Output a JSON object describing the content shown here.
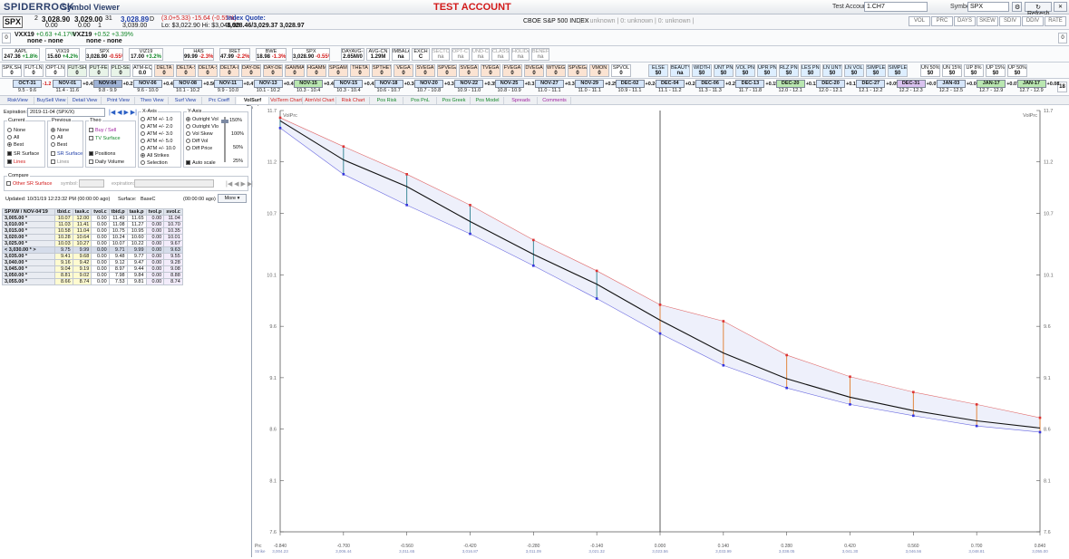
{
  "titlebar": {
    "logo": "SPIDERROCK",
    "app_name": "Symbol Viewer",
    "account_banner": "TEST ACCOUNT",
    "test_account_label": "Test Account:",
    "test_account_value": "1.CH7",
    "symbol_label": "Symbol:",
    "symbol_value": "SPX",
    "refresh_label": "Refresh",
    "window_buttons": [
      "▁",
      "❐",
      "✕"
    ]
  },
  "quote": {
    "symbol": "SPX",
    "bid_size": "2",
    "bid": "3,028.90",
    "ask": "3,029.00",
    "ask_size": "31",
    "last": "3,028.89",
    "last_suffix": "D",
    "sub_bid": "0.00",
    "sub_ask": "0.00",
    "sub_ask_size": "1",
    "sub_last": "3,039.00",
    "change": "(3.0+5.33) -15.64 (-0.55%)",
    "lo_hi": "Lo: $3,022.90  Hi: $3,046.90",
    "index_label": "Index Quote:",
    "index_value": "3,028.46/3,029.37 3,028.97",
    "name_cell": "CBOE S&P 500 INDEX",
    "name_status": "| 0: unknown | 0: unknown | 0: unknown |",
    "right_buttons": [
      "VOL",
      "PRC",
      "DAYS",
      "SKEW",
      "SDIV",
      "DDIV",
      "RATE"
    ]
  },
  "vx_strip": {
    "items": [
      {
        "name": "VXX19",
        "text": "+0.63  +4.17%",
        "sub": "none - none"
      },
      {
        "name": "VXZ19",
        "text": "+0.52  +3.39%",
        "sub": "none - none"
      }
    ],
    "corner": "0"
  },
  "metrics": [
    {
      "label": "AAPL",
      "value": "247.36",
      "chg": "+1.8%",
      "cls": "green"
    },
    {
      "label": "VIX19",
      "value": "15.60",
      "chg": "+4.2%",
      "cls": "green"
    },
    {
      "label": "SPX",
      "value": "3,028.90",
      "chg": "-0.55%",
      "cls": "red"
    },
    {
      "label": "VIZ19",
      "value": "17.00",
      "chg": "+3.2%",
      "cls": "green"
    },
    {
      "label": "HAS",
      "value": "99.99",
      "chg": "-2.3%",
      "cls": "red"
    },
    {
      "label": "IRET",
      "value": "47.99",
      "chg": "-2.2%",
      "cls": "red"
    },
    {
      "label": "BWE",
      "value": "18.98",
      "chg": "-1.3%",
      "cls": "red"
    },
    {
      "label": "SPX",
      "value": "3,028.90",
      "chg": "-0.55%",
      "cls": "red"
    }
  ],
  "metrics_right": [
    {
      "label": "DAYAVG-SH",
      "value": "2.65M/0"
    },
    {
      "label": "AVG-CN",
      "value": "1.29M"
    },
    {
      "label": "IMBALANCE",
      "value": "na"
    },
    {
      "label": "EXCH",
      "value": "C"
    },
    {
      "label": "SECTOR",
      "value": "na"
    },
    {
      "label": "OPT-CTRL",
      "value": "na"
    },
    {
      "label": "UND-CTRL",
      "value": "na"
    },
    {
      "label": "CLASS",
      "value": "na"
    },
    {
      "label": "HOLIDAYSIGN",
      "value": "na"
    },
    {
      "label": "BENEFIT",
      "value": "na"
    }
  ],
  "greek_cells": [
    {
      "l": "SPK.SH",
      "v": "0"
    },
    {
      "l": "FUT-LN",
      "v": "0"
    },
    {
      "l": "OPT-LN",
      "v": "0"
    },
    {
      "l": "FUT-SH",
      "v": "0"
    },
    {
      "l": "PUT-FEE",
      "v": "0"
    },
    {
      "l": "PLD-SELL",
      "v": "0"
    },
    {
      "l": "ATM-EQ-LN",
      "v": "0.0"
    },
    {
      "l": "DELTA",
      "v": "0"
    },
    {
      "l": "DELTA-S",
      "v": "0"
    },
    {
      "l": "DELTA-S",
      "v": "0"
    },
    {
      "l": "DELTA-L",
      "v": "0"
    },
    {
      "l": "DAY-DELTA",
      "v": "0"
    },
    {
      "l": "DAY-DELTA",
      "v": "0"
    },
    {
      "l": "GAMMA",
      "v": "0"
    },
    {
      "l": "HGAMMA",
      "v": "0"
    },
    {
      "l": "SPGAMMA",
      "v": "0"
    },
    {
      "l": "THETA",
      "v": "0"
    },
    {
      "l": "SPTHETA",
      "v": "0"
    },
    {
      "l": "VEGA",
      "v": "0"
    },
    {
      "l": "SVEGA",
      "v": "0"
    },
    {
      "l": "SPVEGA",
      "v": "0"
    },
    {
      "l": "SVEGA",
      "v": "0"
    },
    {
      "l": "TVEGA",
      "v": "0"
    },
    {
      "l": "FVEGA",
      "v": "0"
    },
    {
      "l": "DVEGA",
      "v": "0"
    },
    {
      "l": "WTVEGA",
      "v": "0"
    },
    {
      "l": "SPVEGA",
      "v": "0"
    },
    {
      "l": "VMON",
      "v": "0"
    },
    {
      "l": "SPVOL",
      "v": "0"
    },
    {
      "l": "ELSE",
      "v": "$0"
    },
    {
      "l": "BEAUTY",
      "v": "na"
    },
    {
      "l": "WIDTH",
      "v": "$0"
    },
    {
      "l": "UNT PNL",
      "v": "$0"
    },
    {
      "l": "VOL PNL",
      "v": "$0"
    },
    {
      "l": "UPR PNL",
      "v": "$0"
    },
    {
      "l": "RLZ PNL",
      "v": "$0"
    },
    {
      "l": "LES PNL",
      "v": "$0"
    },
    {
      "l": "LN UNT PNL",
      "v": "$0"
    },
    {
      "l": "LN VOL PNL",
      "v": "$0"
    },
    {
      "l": "SIMPLE PNL",
      "v": "$0"
    },
    {
      "l": "SIMPLEV PNL",
      "v": "$0"
    },
    {
      "l": "UN 50%",
      "v": "$0"
    },
    {
      "l": "UN 15%",
      "v": "$0"
    },
    {
      "l": "UP 8%",
      "v": "$0"
    },
    {
      "l": "UP 15%",
      "v": "$0"
    },
    {
      "l": "UP 50%",
      "v": "$0"
    }
  ],
  "expiries": [
    {
      "lab": "OCT-31",
      "rng": "9.5 - 9.6",
      "chg": "-1.2",
      "hl": "blue"
    },
    {
      "lab": "NOV-01",
      "rng": "11.4 - 11.6",
      "chg": "+0.41",
      "hl": "blue"
    },
    {
      "lab": "NOV-04",
      "rng": "9.8 - 9.9",
      "chg": "+0.21",
      "hl": "dark"
    },
    {
      "lab": "NOV-06",
      "rng": "9.6 - 10.0",
      "chg": "+0.42",
      "hl": "blue"
    },
    {
      "lab": "NOV-08",
      "rng": "10.1 - 10.2",
      "chg": "+0.50",
      "hl": "blue"
    },
    {
      "lab": "NOV-11",
      "rng": "9.9 - 10.0",
      "chg": "+0.47",
      "hl": "blue"
    },
    {
      "lab": "NOV-13",
      "rng": "10.1 - 10.2",
      "chg": "+0.43",
      "hl": "blue"
    },
    {
      "lab": "NOV-15",
      "rng": "10.3 - 10.4",
      "chg": "+0.41",
      "hl": "green"
    },
    {
      "lab": "NOV-15",
      "rng": "10.3 - 10.4",
      "chg": "+0.41",
      "hl": "blue"
    },
    {
      "lab": "NOV-18",
      "rng": "10.6 - 10.7",
      "chg": "+0.38",
      "hl": "blue"
    },
    {
      "lab": "NOV-20",
      "rng": "10.7 - 10.8",
      "chg": "+0.32",
      "hl": "blue"
    },
    {
      "lab": "NOV-22",
      "rng": "10.9 - 11.0",
      "chg": "+0.35",
      "hl": "blue"
    },
    {
      "lab": "NOV-25",
      "rng": "10.8 - 10.9",
      "chg": "+0.31",
      "hl": "blue"
    },
    {
      "lab": "NOV-27",
      "rng": "11.0 - 11.1",
      "chg": "+0.30",
      "hl": "blue"
    },
    {
      "lab": "NOV-29",
      "rng": "11.0 - 11.1",
      "chg": "+0.25",
      "hl": "blue"
    },
    {
      "lab": "DEC-02",
      "rng": "10.9 - 11.1",
      "chg": "+0.24",
      "hl": "blue"
    },
    {
      "lab": "DEC-04",
      "rng": "11.1 - 11.2",
      "chg": "+0.24",
      "hl": "blue"
    },
    {
      "lab": "DEC-06",
      "rng": "11.3 - 11.3",
      "chg": "+0.22",
      "hl": "blue"
    },
    {
      "lab": "DEC-13",
      "rng": "11.7 - 11.8",
      "chg": "+0.15",
      "hl": "blue"
    },
    {
      "lab": "DEC-20",
      "rng": "12.0 - 12.1",
      "chg": "+0.12",
      "hl": "green"
    },
    {
      "lab": "DEC-20",
      "rng": "12.0 - 12.1",
      "chg": "+0.10",
      "hl": "blue"
    },
    {
      "lab": "DEC-27",
      "rng": "12.1 - 12.2",
      "chg": "+0.09",
      "hl": "blue"
    },
    {
      "lab": "DEC-31",
      "rng": "12.2 - 12.3",
      "chg": "+0.07",
      "hl": "purple"
    },
    {
      "lab": "JAN-03",
      "rng": "12.2 - 12.5",
      "chg": "+0.00",
      "hl": "blue"
    },
    {
      "lab": "JAN-17",
      "rng": "12.7 - 12.9",
      "chg": "+0.07",
      "hl": "green"
    },
    {
      "lab": "JAN-17",
      "rng": "12.7 - 12.9",
      "chg": "+0.08",
      "hl": "green"
    }
  ],
  "expiry_corner": "18",
  "tabs": [
    "RiskView",
    "BuySell View",
    "Detail View",
    "Print View",
    "Theo View",
    "Surf View",
    "Prc Coeff",
    "VolSurf Chart",
    "VolTerm Chart",
    "AtmVol Chart",
    "Risk Chart",
    "Pos Risk",
    "Pos PnL",
    "Pos Greek",
    "Pos Model",
    "Spreads",
    "Comments"
  ],
  "active_tab": "VolSurf Chart",
  "left": {
    "expiration_label": "Expiration:",
    "expiration_value": "2019-11-04 (SPX/X)",
    "current_label": "Current",
    "current_opts": [
      "None",
      "All",
      "Best"
    ],
    "current_checks": [
      "SR Surface",
      "Lines"
    ],
    "previous_label": "Previous",
    "previous_opts": [
      "None",
      "All",
      "Best"
    ],
    "previous_checks": [
      "SR Surface",
      "Lines"
    ],
    "theo_label": "Theo",
    "theo_checks": [
      "Buy / Sell",
      "TV Surface",
      "Positions",
      "Daily Volume"
    ],
    "xaxis_label": "X-Axis",
    "xaxis_opts": [
      "ATM +/- 1.0",
      "ATM +/- 2.0",
      "ATM +/- 3.0",
      "ATM +/- 5.0",
      "ATM +/- 10.0",
      "All Strikes",
      "Selection"
    ],
    "yaxis_label": "Y-Axis",
    "yaxis_opts": [
      "Outright Vol",
      "Outright Vlo",
      "Vol Skew",
      "Diff Vol",
      "Diff Price"
    ],
    "autoscale_label": "Auto scale",
    "slider_marks": [
      "150%",
      "100%",
      "50%",
      "25%"
    ],
    "compare_label": "Compare",
    "other_surface_label": "Other SR Surface",
    "symbol_label": "symbol:",
    "expiration2_label": "expiration:",
    "updated": "Updated:  10/31/19 12:23:32 PM (00:00:00 ago)",
    "surface_label": "Surface:",
    "surface_value": "BaseC",
    "surface_age": "(00:00:00 ago)",
    "more_label": "More"
  },
  "grid": {
    "headers": [
      "SPXW / NOV-04'19",
      "tbid.c",
      "task.c",
      "tvol.c",
      "tbid.p",
      "task.p",
      "tvol.p",
      "svol.c"
    ],
    "rows": [
      [
        "3,005.00 *",
        "10.07",
        "12.00",
        "0.00",
        "11.49",
        "11.65",
        "0.00",
        "11.04"
      ],
      [
        "3,010.00 *",
        "11.03",
        "11.41",
        "0.00",
        "11.08",
        "11.27",
        "0.00",
        "10.70"
      ],
      [
        "3,015.00 *",
        "10.58",
        "11.04",
        "0.00",
        "10.75",
        "10.95",
        "0.00",
        "10.35"
      ],
      [
        "3,020.00 *",
        "10.28",
        "10.64",
        "0.00",
        "10.24",
        "10.60",
        "0.00",
        "10.01"
      ],
      [
        "3,025.00 *",
        "10.03",
        "10.27",
        "0.00",
        "10.07",
        "10.22",
        "0.00",
        "9.67"
      ],
      [
        "< 3,030.00 * >",
        "9.75",
        "9.99",
        "0.00",
        "9.71",
        "9.99",
        "0.00",
        "9.63"
      ],
      [
        "3,035.00 *",
        "9.41",
        "9.68",
        "0.00",
        "9.48",
        "9.77",
        "0.00",
        "9.55"
      ],
      [
        "3,040.00 *",
        "9.16",
        "9.42",
        "0.00",
        "9.12",
        "9.47",
        "0.00",
        "9.28"
      ],
      [
        "3,045.00 *",
        "9.04",
        "9.19",
        "0.00",
        "8.97",
        "9.44",
        "0.00",
        "9.08"
      ],
      [
        "3,050.00 *",
        "8.81",
        "9.02",
        "0.00",
        "7.98",
        "9.84",
        "0.00",
        "8.88"
      ],
      [
        "3,055.00 *",
        "8.66",
        "8.74",
        "0.00",
        "7.53",
        "9.81",
        "0.00",
        "8.74"
      ]
    ],
    "atm_index": 5
  },
  "chart_data": {
    "type": "line",
    "title": "",
    "ylim": [
      7.6,
      11.7
    ],
    "yticks": [
      7.6,
      8.1,
      8.6,
      9.1,
      9.6,
      10.1,
      10.7,
      11.2,
      11.7
    ],
    "xlim": [
      -0.84,
      0.84
    ],
    "xticks": [
      -0.84,
      -0.7,
      -0.56,
      -0.42,
      -0.28,
      -0.14,
      0.0,
      0.14,
      0.28,
      0.42,
      0.56,
      0.7,
      0.84
    ],
    "xtick_labels": [
      "-0.840",
      "-0.700",
      "-0.560",
      "-0.420",
      "-0.280",
      "-0.140",
      "0.000",
      "0.140",
      "0.280",
      "0.420",
      "0.560",
      "0.700",
      "0.840"
    ],
    "xtick_prices": [
      "3,004.23",
      "3,006.44",
      "3,011.65",
      "3,016.87",
      "3,011.09",
      "3,021.32",
      "3,023.56",
      "3,033.99",
      "3,038.05",
      "3,041.30",
      "3,046.56",
      "3,048.81",
      "3,055.00"
    ],
    "xlabel_row1": "Prc",
    "xlabel_row2": "Strike",
    "left_corner_label": "VolPrc",
    "right_corner_label": "VolPrc",
    "series": [
      {
        "name": "",
        "color": "#111111",
        "x": [
          -0.84,
          -0.7,
          -0.56,
          -0.42,
          -0.28,
          -0.14,
          0.0,
          0.14,
          0.28,
          0.42,
          0.56,
          0.7,
          0.84
        ],
        "y": [
          11.6,
          11.22,
          10.96,
          10.62,
          10.3,
          10.01,
          9.66,
          9.34,
          9.09,
          8.91,
          8.78,
          8.68,
          8.61
        ]
      }
    ],
    "bands": {
      "x": [
        -0.84,
        -0.7,
        -0.56,
        -0.42,
        -0.28,
        -0.14,
        0.0,
        0.14,
        0.28,
        0.42,
        0.56,
        0.7,
        0.84
      ],
      "upper": [
        11.63,
        11.35,
        11.08,
        10.78,
        10.44,
        10.14,
        9.81,
        9.65,
        9.32,
        9.11,
        8.96,
        8.84,
        8.71
      ],
      "lower": [
        11.53,
        11.08,
        10.78,
        10.5,
        10.19,
        9.87,
        9.53,
        9.22,
        9.0,
        8.84,
        8.73,
        8.63,
        8.57
      ],
      "upper_color": "#e06a6a",
      "lower_color": "#6a6ae0"
    }
  }
}
